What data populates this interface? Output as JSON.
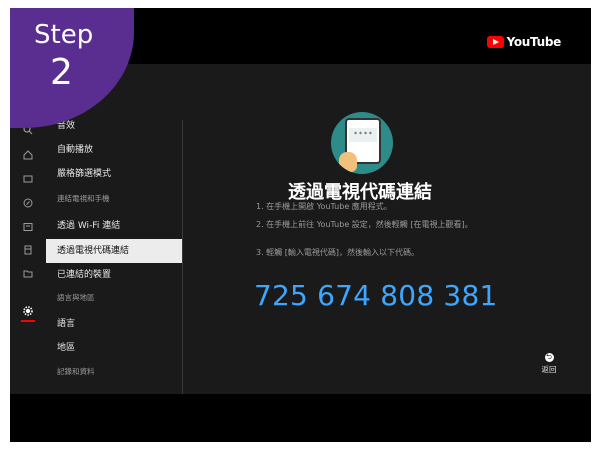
{
  "badge": {
    "step_label": "Step",
    "step_number": "2"
  },
  "header": {
    "logo_text": "YouTube"
  },
  "rail_icons": [
    "search-icon",
    "home-icon",
    "subscriptions-icon",
    "explore-icon",
    "library-icon",
    "clip-icon",
    "folder-icon",
    "gear-icon"
  ],
  "menu": {
    "items": [
      {
        "label": "音效",
        "type": "item"
      },
      {
        "label": "自動播放",
        "type": "item"
      },
      {
        "label": "嚴格篩選模式",
        "type": "item"
      },
      {
        "label": "連結電視和手機",
        "type": "heading"
      },
      {
        "label": "透過 Wi-Fi 連結",
        "type": "item"
      },
      {
        "label": "透過電視代碼連結",
        "type": "item",
        "selected": true
      },
      {
        "label": "已連結的裝置",
        "type": "item"
      },
      {
        "label": "語言與地區",
        "type": "heading"
      },
      {
        "label": "語言",
        "type": "item"
      },
      {
        "label": "地區",
        "type": "item"
      },
      {
        "label": "記錄和資料",
        "type": "heading"
      }
    ]
  },
  "main": {
    "title": "透過電視代碼連結",
    "steps": [
      "1.  在手機上開啟 YouTube 應用程式。",
      "2.  在手機上前往 YouTube 設定，然後輕觸 [在電視上觀看]。",
      "3.  輕觸 [輸入電視代碼]，然後輸入以下代碼。"
    ],
    "tv_code": "725 674 808 381"
  },
  "back_button": {
    "label": "返回"
  },
  "colors": {
    "badge": "#5a2d91",
    "accent_blue": "#3ea6ff",
    "youtube_red": "#ff0000",
    "background": "#1a1a1a"
  }
}
